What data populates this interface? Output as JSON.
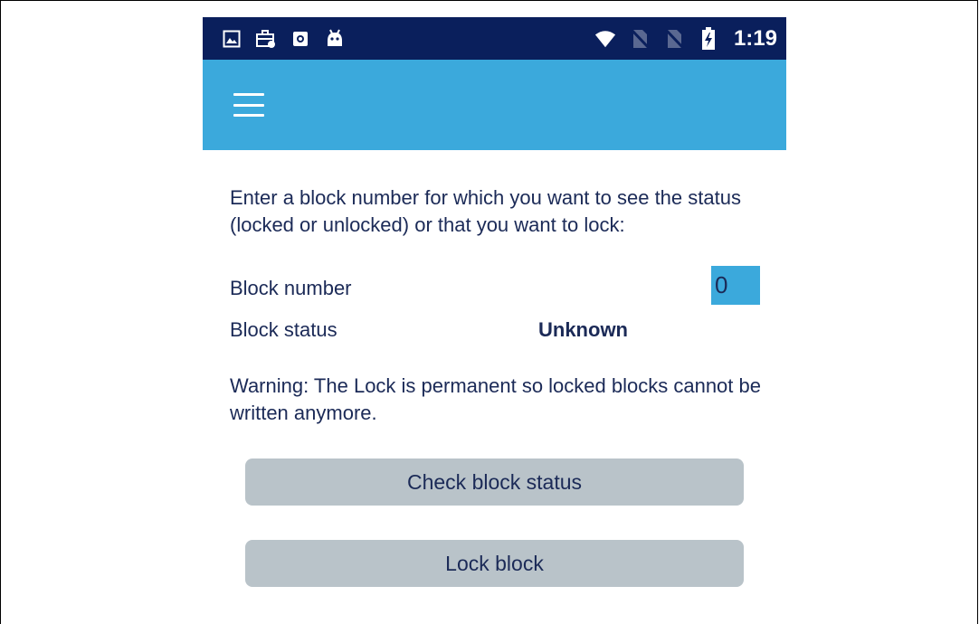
{
  "status_bar": {
    "time": "1:19",
    "left_icons": [
      "image-icon",
      "work-profile-icon",
      "camera-icon",
      "android-icon"
    ],
    "right_icons": [
      "wifi-icon",
      "no-sim-icon",
      "no-sim-icon",
      "battery-charging-icon"
    ]
  },
  "app_bar": {
    "menu_icon": "hamburger-menu-icon",
    "color": "#3ba9dc"
  },
  "main": {
    "intro": "Enter a block number for which you want to see the status (locked or unlocked) or that you want to lock:",
    "block_number_label": "Block number",
    "block_number_value": "0",
    "block_status_label": "Block status",
    "block_status_value": "Unknown",
    "warning": "Warning: The Lock is permanent so locked blocks cannot be written anymore.",
    "check_button_label": "Check block status",
    "lock_button_label": "Lock block"
  },
  "colors": {
    "status_bar_bg": "#0a1f5c",
    "accent": "#3ba9dc",
    "text": "#1b2a57",
    "button_bg": "#b9c3c9"
  }
}
